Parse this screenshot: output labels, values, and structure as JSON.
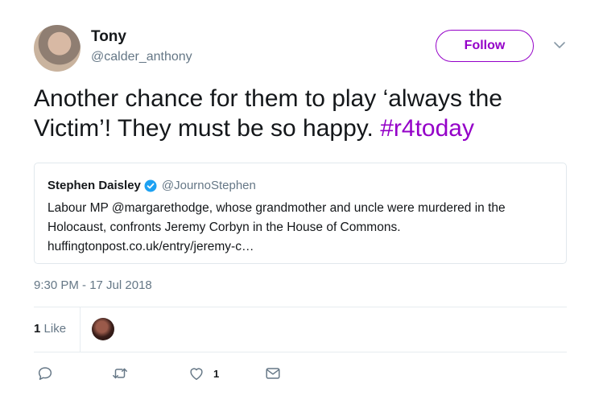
{
  "tweet": {
    "author_name": "Tony",
    "author_handle": "@calder_anthony",
    "follow_label": "Follow",
    "text_plain": "Another chance for them to play ‘always the Victim’! They must be so happy. ",
    "hashtag": "#r4today",
    "timestamp": "9:30 PM - 17 Jul 2018"
  },
  "quote": {
    "author_name": "Stephen Daisley",
    "author_handle": "@JournoStephen",
    "lines": [
      "Labour MP @margarethodge, whose grandmother and uncle were murdered in the",
      "Holocaust, confronts Jeremy Corbyn in the House of Commons.",
      "huffingtonpost.co.uk/entry/jeremy-c…"
    ]
  },
  "stats": {
    "likes_count": "1",
    "likes_label": "Like"
  },
  "actions": {
    "like_count": "1",
    "icons": [
      "reply-icon",
      "retweet-icon",
      "heart-icon",
      "message-icon"
    ]
  },
  "colors": {
    "accent": "#9400c8",
    "secondary_text": "#657786",
    "border": "#e1e8ed"
  }
}
